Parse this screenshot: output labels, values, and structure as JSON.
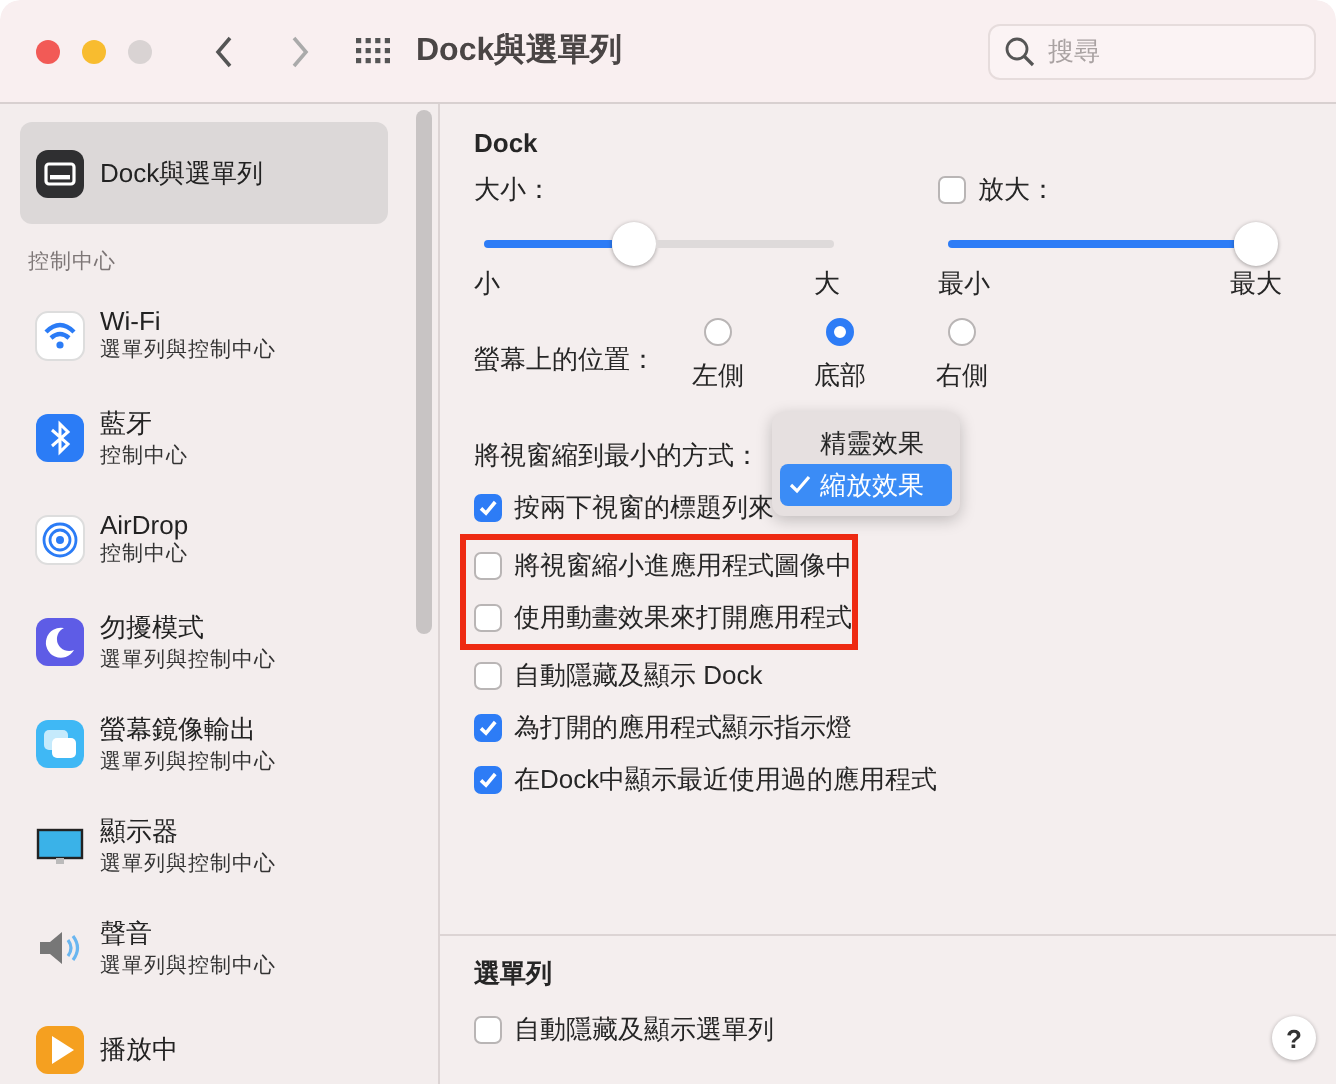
{
  "window": {
    "title": "Dock與選單列",
    "search": {
      "placeholder": "搜尋"
    }
  },
  "sidebar": {
    "items": [
      {
        "label": "Dock與選單列",
        "selected": true
      }
    ],
    "section": "控制中心",
    "controls": [
      {
        "label": "Wi-Fi",
        "subtitle": "選單列與控制中心"
      },
      {
        "label": "藍牙",
        "subtitle": "控制中心"
      },
      {
        "label": "AirDrop",
        "subtitle": "控制中心"
      },
      {
        "label": "勿擾模式",
        "subtitle": "選單列與控制中心"
      },
      {
        "label": "螢幕鏡像輸出",
        "subtitle": "選單列與控制中心"
      },
      {
        "label": "顯示器",
        "subtitle": "選單列與控制中心"
      },
      {
        "label": "聲音",
        "subtitle": "選單列與控制中心"
      },
      {
        "label": "播放中"
      }
    ]
  },
  "dock": {
    "heading": "Dock",
    "size": {
      "label": "大小：",
      "level": 0.42,
      "min_label": "小",
      "max_label": "大"
    },
    "magnification": {
      "label": "放大：",
      "checked": false,
      "level": 1,
      "min_label": "最小",
      "max_label": "最大"
    },
    "position": {
      "label": "螢幕上的位置：",
      "options": [
        {
          "label": "左側",
          "selected": false
        },
        {
          "label": "底部",
          "selected": true
        },
        {
          "label": "右側",
          "selected": false
        }
      ]
    },
    "minimize": {
      "label": "將視窗縮到最小的方式：",
      "menu": [
        {
          "label": "精靈效果",
          "selected": false
        },
        {
          "label": "縮放效果",
          "selected": true
        }
      ]
    },
    "options": [
      {
        "label": "按兩下視窗的標題列來",
        "checked": true,
        "highlighted": false
      },
      {
        "label": "將視窗縮小進應用程式圖像中",
        "checked": false,
        "highlighted": true
      },
      {
        "label": "使用動畫效果來打開應用程式",
        "checked": false,
        "highlighted": true
      },
      {
        "label": "自動隱藏及顯示 Dock",
        "checked": false,
        "highlighted": false
      },
      {
        "label": "為打開的應用程式顯示指示燈",
        "checked": true,
        "highlighted": false
      },
      {
        "label": "在Dock中顯示最近使用過的應用程式",
        "checked": true,
        "highlighted": false
      }
    ]
  },
  "menu_bar": {
    "heading": "選單列",
    "options": [
      {
        "label": "自動隱藏及顯示選單列",
        "checked": false
      }
    ],
    "help": "?"
  }
}
